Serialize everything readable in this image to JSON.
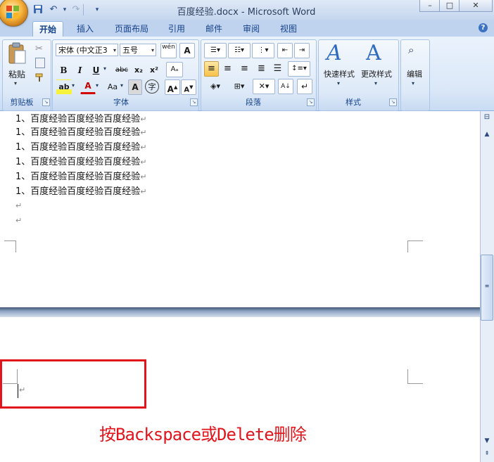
{
  "window": {
    "title": "百度经验.docx - Microsoft Word",
    "minimize_glyph": "–",
    "maximize_glyph": "□",
    "close_glyph": "✕"
  },
  "qat": {
    "save_glyph": "💾",
    "undo_glyph": "↶",
    "redo_glyph": "↷",
    "dropdown_glyph": "▾"
  },
  "tabs": [
    {
      "label": "开始",
      "active": true
    },
    {
      "label": "插入"
    },
    {
      "label": "页面布局"
    },
    {
      "label": "引用"
    },
    {
      "label": "邮件"
    },
    {
      "label": "审阅"
    },
    {
      "label": "视图"
    }
  ],
  "help_glyph": "?",
  "ribbon": {
    "clipboard": {
      "label": "剪贴板",
      "paste_label": "粘贴"
    },
    "font": {
      "label": "字体",
      "font_name": "宋体 (中文正3",
      "font_size": "五号",
      "phonetic_glyph": "wén",
      "bold": "B",
      "italic": "I",
      "underline": "U",
      "strike": "abc",
      "subscript": "x₂",
      "superscript": "x²",
      "highlight": "ab",
      "font_color": "A",
      "change_case": "Aa",
      "char_shading": "A",
      "enclose": "字",
      "grow": "A",
      "shrink": "A"
    },
    "paragraph": {
      "label": "段落"
    },
    "styles": {
      "label": "样式",
      "quick_styles": "快速样式",
      "change_styles": "更改样式"
    },
    "editing": {
      "label": "编辑"
    }
  },
  "document": {
    "lines": [
      "1、百度经验百度经验百度经验",
      "1、百度经验百度经验百度经验",
      "1、百度经验百度经验百度经验",
      "1、百度经验百度经验百度经验",
      "1、百度经验百度经验百度经验",
      "1、百度经验百度经验百度经验"
    ],
    "paragraph_mark": "↵",
    "empty_mark": "↵"
  },
  "annotation": "按Backspace或Delete删除",
  "colors": {
    "annotation_red": "#e0161c",
    "ribbon_blue": "#15428b"
  }
}
